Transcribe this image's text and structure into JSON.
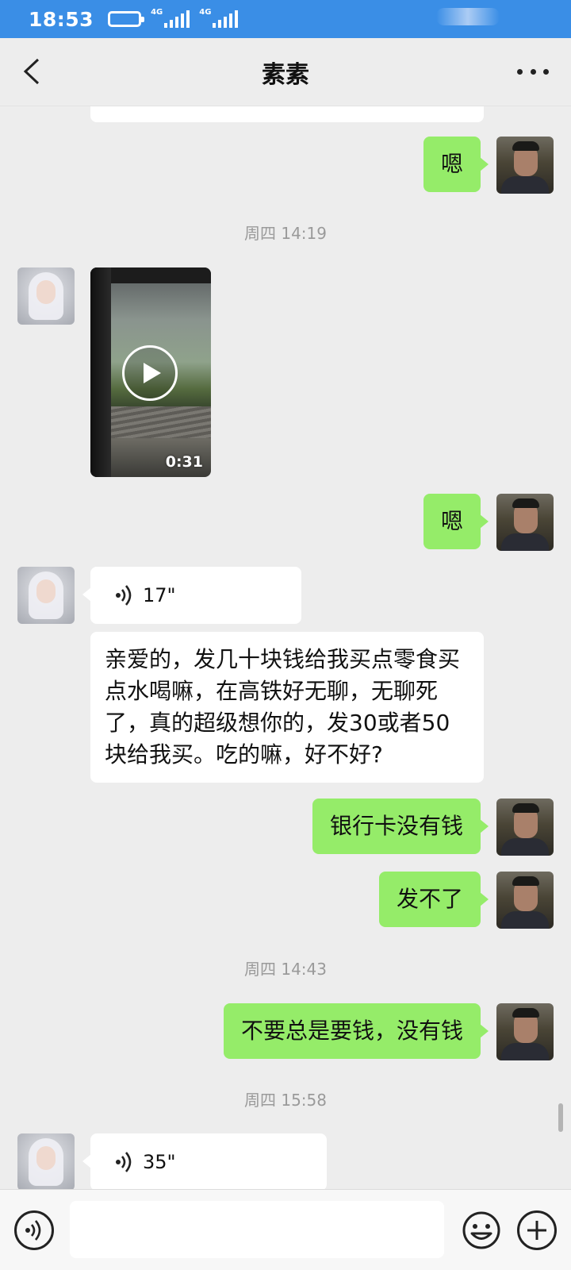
{
  "status_bar": {
    "time": "18:53",
    "network_1": "4G",
    "network_2": "4G"
  },
  "header": {
    "title": "素素"
  },
  "messages": [
    {
      "sender": "me",
      "type": "text",
      "text": "嗯"
    },
    {
      "type": "timestamp",
      "text": "周四 14:19"
    },
    {
      "sender": "her",
      "type": "video",
      "duration": "0:31"
    },
    {
      "sender": "me",
      "type": "text",
      "text": "嗯"
    },
    {
      "sender": "her",
      "type": "voice",
      "duration": "17\""
    },
    {
      "sender": "her",
      "type": "text",
      "text": "亲爱的，发几十块钱给我买点零食买点水喝嘛，在高铁好无聊，无聊死了，真的超级想你的，发30或者50块给我买。吃的嘛，好不好?"
    },
    {
      "sender": "me",
      "type": "text",
      "text": "银行卡没有钱"
    },
    {
      "sender": "me",
      "type": "text",
      "text": "发不了"
    },
    {
      "type": "timestamp",
      "text": "周四 14:43"
    },
    {
      "sender": "me",
      "type": "text",
      "text": "不要总是要钱，没有钱"
    },
    {
      "type": "timestamp",
      "text": "周四 15:58"
    },
    {
      "sender": "her",
      "type": "voice",
      "duration": "35\""
    }
  ],
  "colors": {
    "status_bar": "#3a8ee6",
    "my_bubble": "#95ec69",
    "her_bubble": "#ffffff",
    "background": "#ededed"
  }
}
